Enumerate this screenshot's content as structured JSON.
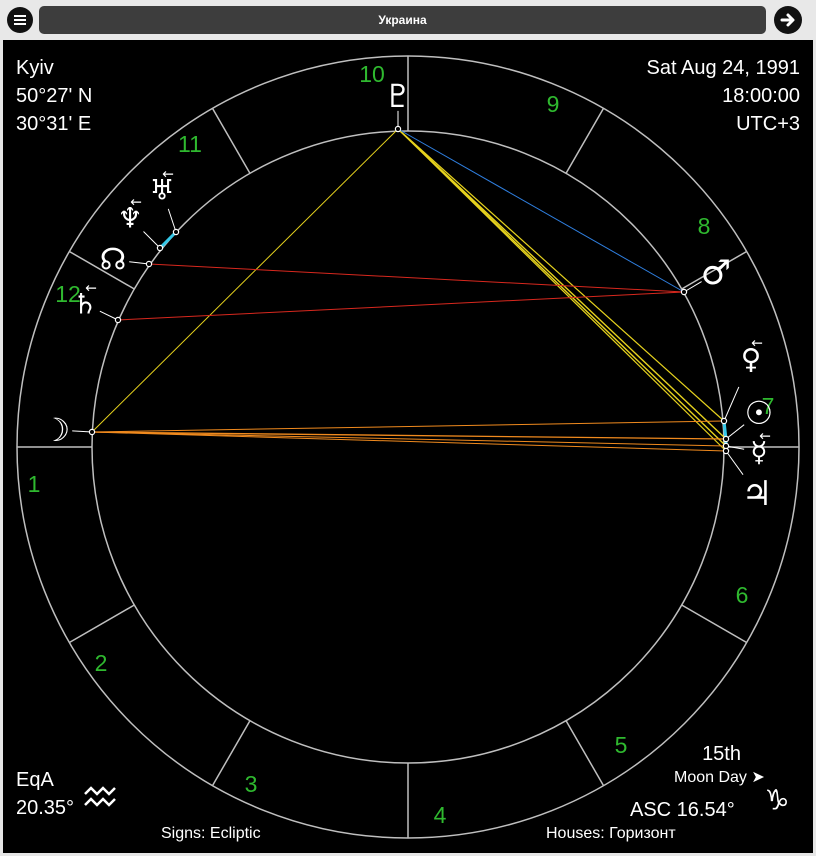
{
  "header": {
    "title": "Украина"
  },
  "location": {
    "city": "Kyiv",
    "latitude": "50°27' N",
    "longitude": "30°31' E"
  },
  "datetime": {
    "date": "Sat Aug 24, 1991",
    "time": "18:00:00",
    "timezone": "UTC+3"
  },
  "equinox": {
    "label": "EqA",
    "value": "20.35°",
    "sign_icon": "aquarius-icon"
  },
  "moon_day": {
    "number": "15th",
    "label": "Moon Day",
    "arrow": "➤"
  },
  "ascendant": {
    "label": "ASC 16.54°",
    "sign_icon": "capricorn-icon"
  },
  "footer": {
    "signs": "Signs: Ecliptic",
    "houses": "Houses: Горизонт"
  },
  "houses": [
    "1",
    "2",
    "3",
    "4",
    "5",
    "6",
    "7",
    "8",
    "9",
    "10",
    "11",
    "12"
  ],
  "planets": [
    {
      "name": "pluto",
      "glyph": "♇",
      "retrograde": false
    },
    {
      "name": "uranus",
      "glyph": "♅",
      "retrograde": true
    },
    {
      "name": "neptune",
      "glyph": "♆",
      "retrograde": true
    },
    {
      "name": "node",
      "glyph": "☊",
      "retrograde": false
    },
    {
      "name": "saturn",
      "glyph": "♄",
      "retrograde": true
    },
    {
      "name": "moon",
      "glyph": "☽",
      "retrograde": false
    },
    {
      "name": "mars",
      "glyph": "♂",
      "retrograde": false
    },
    {
      "name": "venus",
      "glyph": "♀",
      "retrograde": true
    },
    {
      "name": "sun",
      "glyph": "☉",
      "retrograde": false
    },
    {
      "name": "mercury",
      "glyph": "☿",
      "retrograde": true
    },
    {
      "name": "jupiter",
      "glyph": "♃",
      "retrograde": false
    }
  ],
  "colors": {
    "house_numbers": "#2fb92f",
    "ring": "#bfbfbf",
    "aspect_trine": "#e6d21e",
    "aspect_square": "#d8281e",
    "aspect_sextile": "#2f7fe0",
    "aspect_conjunction": "#35c8e8",
    "aspect_opposition": "#f08a1e"
  }
}
